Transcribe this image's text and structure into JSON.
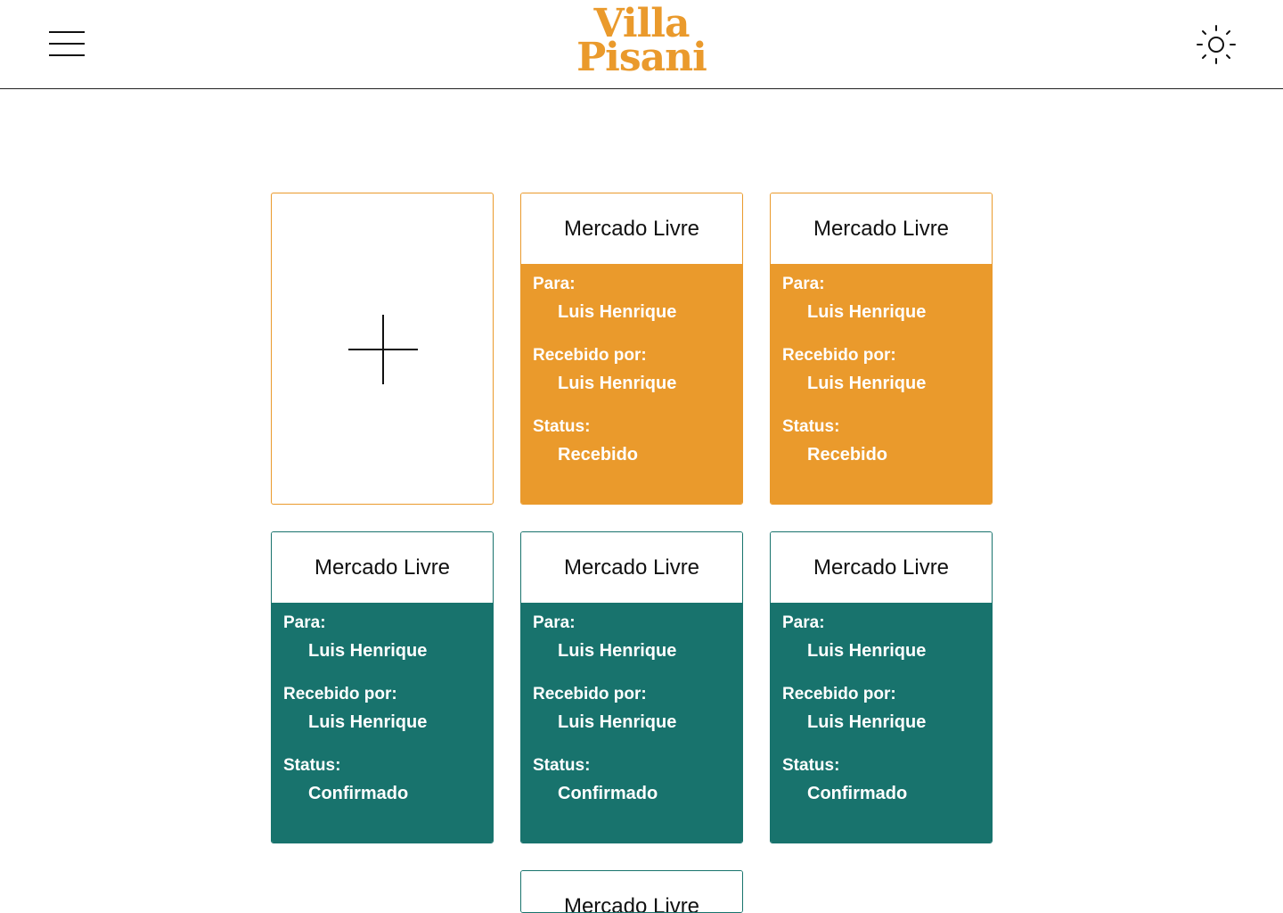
{
  "header": {
    "logo_line1": "Villa",
    "logo_line2": "Pisani",
    "menu_icon": "hamburger-menu-icon",
    "theme_icon": "sun-icon"
  },
  "colors": {
    "brand": "#ea9a2c",
    "received": "#ea9a2c",
    "confirmed": "#18736d"
  },
  "add_card": {
    "icon": "plus-icon"
  },
  "labels": {
    "para": "Para:",
    "recebido_por": "Recebido por:",
    "status": "Status:"
  },
  "cards": [
    {
      "title": "Mercado Livre",
      "para": "Luis Henrique",
      "recebido_por": "Luis Henrique",
      "status": "Recebido"
    },
    {
      "title": "Mercado Livre",
      "para": "Luis Henrique",
      "recebido_por": "Luis Henrique",
      "status": "Recebido"
    },
    {
      "title": "Mercado Livre",
      "para": "Luis Henrique",
      "recebido_por": "Luis Henrique",
      "status": "Confirmado"
    },
    {
      "title": "Mercado Livre",
      "para": "Luis Henrique",
      "recebido_por": "Luis Henrique",
      "status": "Confirmado"
    },
    {
      "title": "Mercado Livre",
      "para": "Luis Henrique",
      "recebido_por": "Luis Henrique",
      "status": "Confirmado"
    },
    {
      "title": "Mercado Livre"
    }
  ]
}
